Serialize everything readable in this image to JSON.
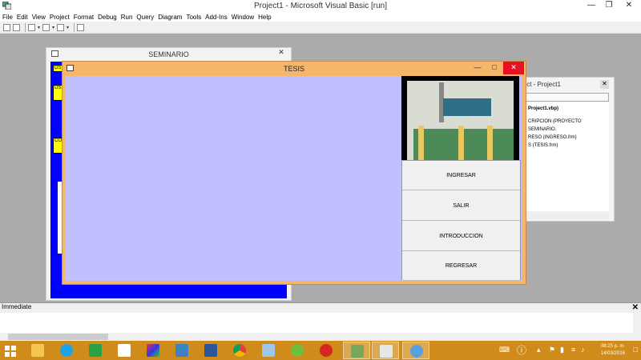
{
  "window": {
    "title": "Project1 - Microsoft Visual Basic [run]"
  },
  "menu": [
    "File",
    "Edit",
    "View",
    "Project",
    "Format",
    "Debug",
    "Run",
    "Query",
    "Diagram",
    "Tools",
    "Add-Ins",
    "Window",
    "Help"
  ],
  "seminario": {
    "title": "SEMINARIO",
    "labels": [
      "DS",
      "US",
      "CO"
    ]
  },
  "tesis": {
    "title": "TESIS",
    "buttons": [
      "INGRESAR",
      "SALIR",
      "INTRODUCCION",
      "REGRESAR"
    ]
  },
  "project_panel": {
    "title": "ject - Project1",
    "tree": [
      "Project1.vbp)",
      "CRIPCION (PROYECTO SEMINARIO.",
      "RESO (INGRESO.frm)",
      "S (TESIS.frm)"
    ]
  },
  "immediate": {
    "title": "Immediate"
  },
  "taskbar": {
    "apps": [
      "file-explorer",
      "internet-explorer",
      "store",
      "dropbox",
      "photos",
      "remote-desktop",
      "word",
      "chrome",
      "notepad",
      "dreamweaver",
      "flash",
      "vb6",
      "vb6-run",
      "chrome-2"
    ],
    "clock_time": "08:25 p. m.",
    "clock_date": "14/03/2016"
  },
  "colors": {
    "taskbar": "#d08c1a",
    "tesis_frame": "#f5b66a",
    "tesis_client": "#c0c0ff",
    "seminario_client": "#0000ff"
  }
}
